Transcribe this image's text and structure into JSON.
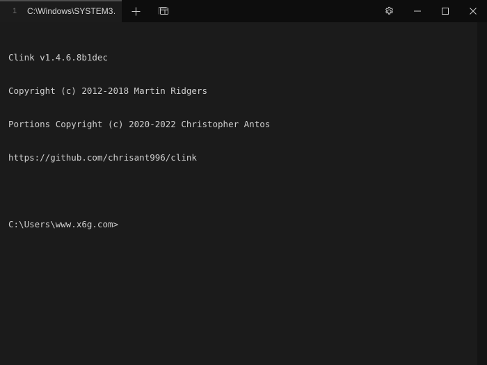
{
  "window": {
    "tab": {
      "index": "1",
      "title": "C:\\Windows\\SYSTEM3…"
    },
    "buttons": {
      "new_tab": "+",
      "panes": "panes",
      "settings": "Settings",
      "minimize": "Minimize",
      "maximize": "Maximize",
      "close": "Close"
    },
    "colors": {
      "titlebar_bg": "#0d0d0d",
      "tab_bg": "#1c1c1c",
      "tab_accent": "#4d4d4d",
      "terminal_bg": "#1b1b1b",
      "terminal_fg": "#cfcfcf"
    }
  },
  "terminal": {
    "lines": [
      "Clink v1.4.6.8b1dec",
      "Copyright (c) 2012-2018 Martin Ridgers",
      "Portions Copyright (c) 2020-2022 Christopher Antos",
      "https://github.com/chrisant996/clink",
      "",
      "C:\\Users\\www.x6g.com>"
    ]
  }
}
